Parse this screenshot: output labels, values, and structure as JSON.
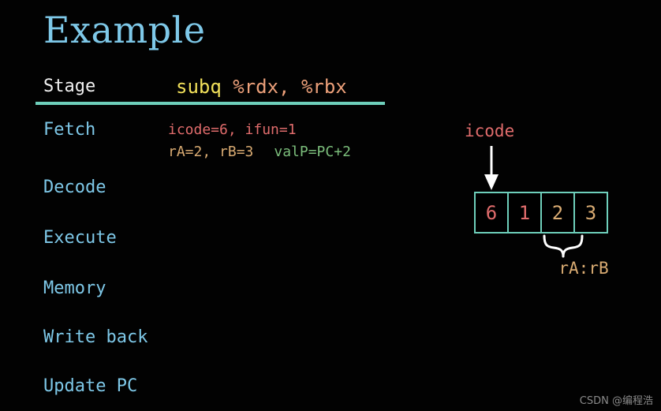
{
  "slide": {
    "title": "Example",
    "background_color": "#000000",
    "title_color": "#7ec8e8",
    "rule_color": "#6ecfbb"
  },
  "table": {
    "header": {
      "stage_column": "Stage",
      "instruction_mnemonic": "subq",
      "instruction_operands": " %rdx, %rbx"
    },
    "rows": [
      {
        "stage": "Fetch",
        "detail_line1": "icode=6, ifun=1",
        "detail_line2_regs": "rA=2, rB=3",
        "detail_line2_valp": "valP=PC+2"
      },
      {
        "stage": "Decode",
        "detail_line1": "",
        "detail_line2_regs": "",
        "detail_line2_valp": ""
      },
      {
        "stage": "Execute",
        "detail_line1": "",
        "detail_line2_regs": "",
        "detail_line2_valp": ""
      },
      {
        "stage": "Memory",
        "detail_line1": "",
        "detail_line2_regs": "",
        "detail_line2_valp": ""
      },
      {
        "stage": "Write back",
        "detail_line1": "",
        "detail_line2_regs": "",
        "detail_line2_valp": ""
      },
      {
        "stage": "Update PC",
        "detail_line1": "",
        "detail_line2_regs": "",
        "detail_line2_valp": ""
      }
    ]
  },
  "diagram": {
    "pointer_label": "icode",
    "pointer_label_color": "#e06c6c",
    "box_border_color": "#6ecfbb",
    "bytes": [
      {
        "value": "6",
        "color": "#e06c6c",
        "kind": "code"
      },
      {
        "value": "1",
        "color": "#e06c6c",
        "kind": "code"
      },
      {
        "value": "2",
        "color": "#d9ab72",
        "kind": "reg"
      },
      {
        "value": "3",
        "color": "#d9ab72",
        "kind": "reg"
      }
    ],
    "brace_label": "rA:rB",
    "brace_label_color": "#d9ab72"
  },
  "watermark": {
    "text": "CSDN @编程浩"
  }
}
